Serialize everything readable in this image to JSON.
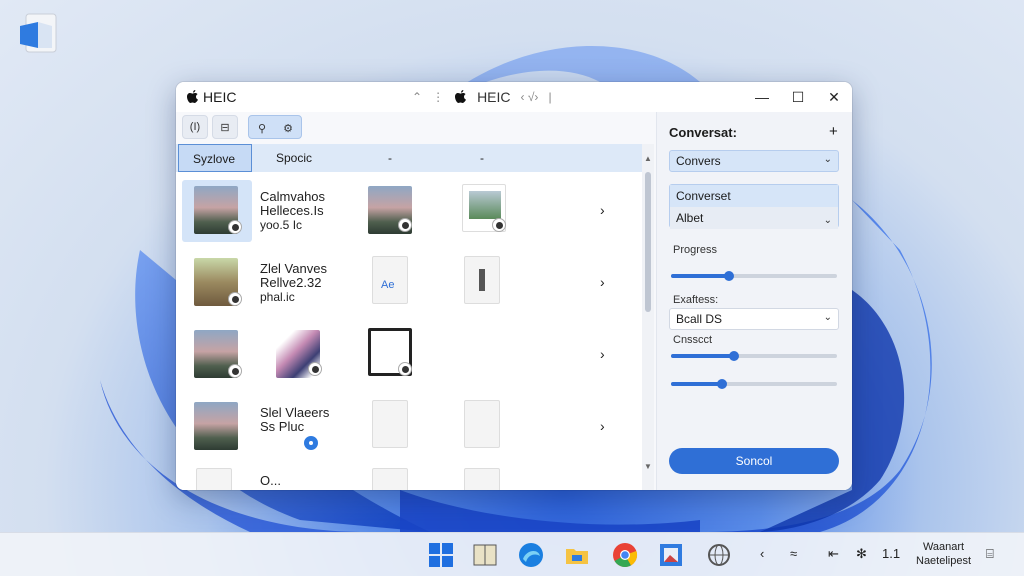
{
  "window": {
    "app_title": "HEIC",
    "center_title": "HEIC",
    "center_prefix": "⌃",
    "center_suffix": "‹ √›",
    "minimize": "—",
    "maximize": "☐",
    "close": "✕"
  },
  "toolbar": {
    "view_label": "(I)",
    "grid_label": "⊟",
    "tool_a": "⚲",
    "tool_b": "⚙"
  },
  "list": {
    "headers": [
      "Syzlove",
      "Spocic",
      "-",
      "-"
    ],
    "rows": [
      {
        "line1": "Calmvahos",
        "line2": "Helleces.Is",
        "line3": "yoo.5 Ic"
      },
      {
        "line1": "Zlel Vanves",
        "line2": "Rellve2.32",
        "line3": "phal.ic"
      },
      {
        "line1": "",
        "line2": "",
        "line3": ""
      },
      {
        "line1": "Slel Vlaeers",
        "line2": "Ss Pluc",
        "line3": ""
      },
      {
        "line1": "O...",
        "line2": "",
        "line3": ""
      }
    ]
  },
  "side": {
    "title": "Conversat:",
    "plus": "+",
    "dropdown1": "Convers",
    "dropdown2_header": "Converset",
    "dropdown2_value": "Albet",
    "progress_label": "Progress",
    "progress_value": 0.35,
    "format_label": "Exaftess:",
    "format_value": "Bcall DS",
    "quality_label": "Cnsscct",
    "quality_value": 0.38,
    "third_value": 0.31,
    "button_label": "Soncol"
  },
  "taskbar": {
    "tray_count": "1.1",
    "clock_line1": "Waanart",
    "clock_line2": "Naetelipest"
  },
  "colors": {
    "accent": "#2f6fd6",
    "selection": "#d4e4f8"
  }
}
